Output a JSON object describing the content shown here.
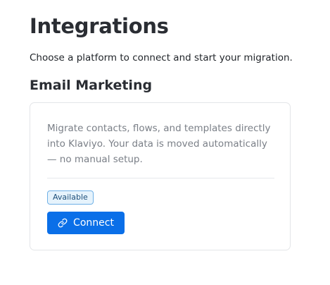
{
  "page": {
    "title": "Integrations",
    "subtitle": "Choose a platform to connect and start your migration."
  },
  "section": {
    "title": "Email Marketing"
  },
  "card": {
    "description": "Migrate contacts, flows, and templates directly into Klaviyo. Your data is moved automatically — no manual setup.",
    "badge": "Available",
    "button_label": "Connect",
    "button_icon": "link-icon"
  },
  "colors": {
    "accent": "#0a6fe8",
    "badge_bg": "#e6f3fc",
    "badge_border": "#6fb0e6"
  }
}
